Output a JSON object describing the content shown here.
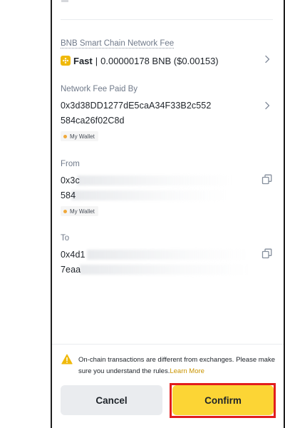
{
  "network_fee": {
    "label": "BNB Smart Chain Network Fee",
    "speed": "Fast",
    "separator": "|",
    "amount": "0.00000178 BNB ($0.00153)"
  },
  "fee_paid_by": {
    "label": "Network Fee Paid By",
    "address_line1": "0x3d38DD1277dE5caA34F33B2c552",
    "address_line2": "584ca26f02C8d",
    "tag": "My Wallet"
  },
  "from": {
    "label": "From",
    "address_line1": "0x3c",
    "address_line2": "584",
    "tag": "My Wallet"
  },
  "to": {
    "label": "To",
    "address_line1": "0x4d1",
    "address_line2": "7eaa"
  },
  "notice": {
    "text": "On-chain transactions are different from exchanges. Please make sure you understand the rules.",
    "link": "Learn More"
  },
  "actions": {
    "cancel": "Cancel",
    "confirm": "Confirm"
  },
  "colors": {
    "accent": "#fcd535",
    "bnb": "#f0b90b",
    "highlight_outline": "#e21d1d",
    "link": "#c99400"
  },
  "icons": {
    "fee_token": "bnb-icon",
    "copy": "copy-icon",
    "warning": "warning-icon",
    "chevron": "chevron-right-icon"
  }
}
